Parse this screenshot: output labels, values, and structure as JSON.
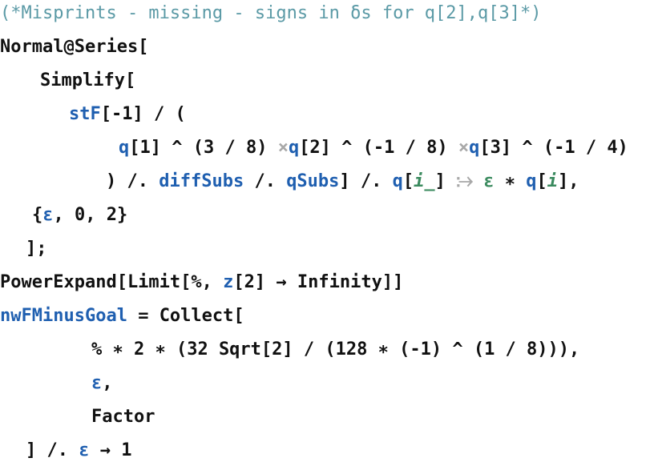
{
  "notebook": {
    "comment": "(*Misprints - missing - signs in δs for q[2],q[3]*)",
    "lines": {
      "l2": {
        "a": "Normal@Series["
      },
      "l3": {
        "a": "Simplify["
      },
      "l4": {
        "g": "stF",
        "a": "[-1] / ("
      },
      "l5": {
        "q1": "q",
        "a": "[1] ^ (3 / 8) ",
        "x1": "×",
        "q2": "q",
        "b": "[2] ^ (-1 / 8) ",
        "x2": "×",
        "q3": "q",
        "c": "[3] ^ (-1 / 4)"
      },
      "l6": {
        "a": ") /. ",
        "d": "diffSubs",
        "b": " /. ",
        "qs": "qSubs",
        "c": "] /. ",
        "q": "q",
        "br1": "[",
        "i1": "i_",
        "br2": "] ",
        "arrow": "⧴",
        "sp": " ",
        "eps": "ε",
        "star": " ∗ ",
        "q2": "q",
        "br3": "[",
        "i2": "i",
        "br4": "],"
      },
      "l7": {
        "a": "{",
        "eps": "ε",
        "b": ", 0, 2}"
      },
      "l8": {
        "a": "];"
      },
      "l9": {
        "a": "PowerExpand[Limit[%, ",
        "z": "z",
        "b": "[2] → Infinity]]"
      },
      "l10": {
        "g": "nwFMinusGoal",
        "a": " = Collect["
      },
      "l11": {
        "a": "% ∗ 2 ∗ (32 Sqrt[2] / (128 ∗ (-1) ^ (1 / 8))),"
      },
      "l12": {
        "eps": "ε",
        "a": ","
      },
      "l13": {
        "a": "Factor"
      },
      "l14": {
        "a": "] /. ",
        "eps": "ε",
        "b": " → 1"
      }
    }
  }
}
